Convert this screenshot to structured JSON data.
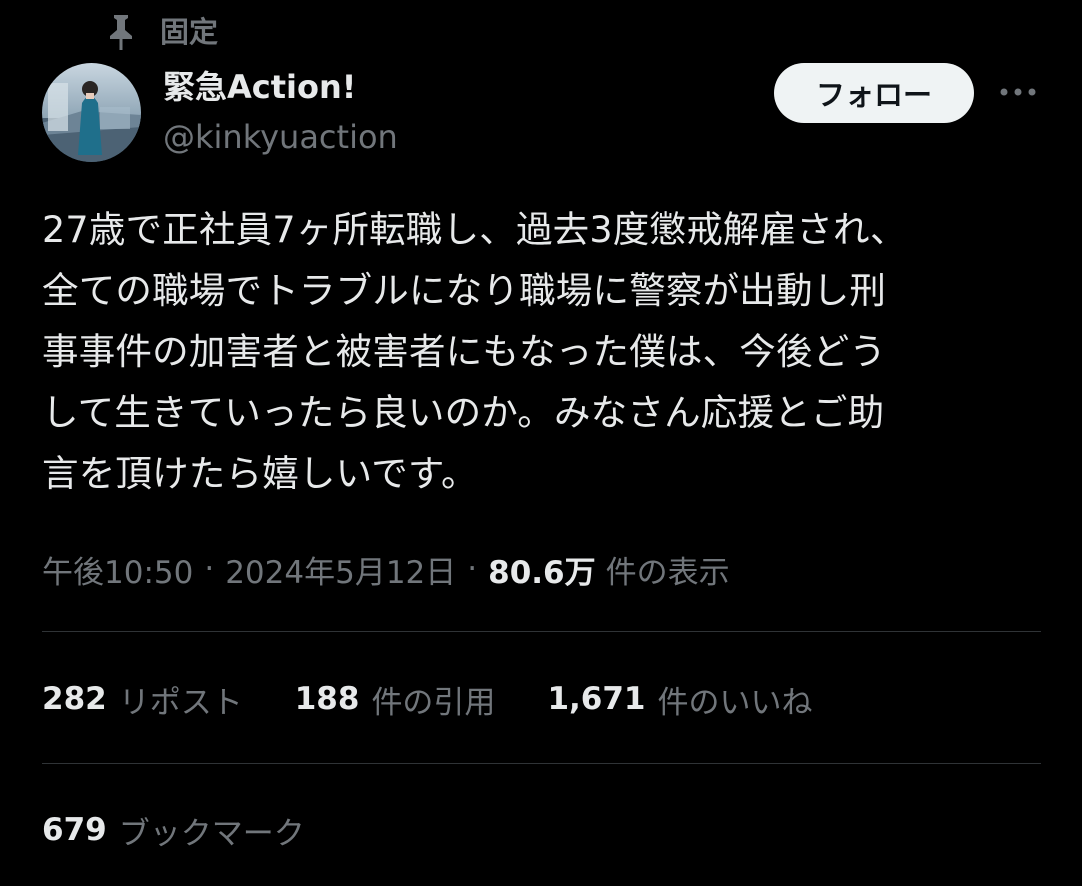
{
  "pinned": {
    "label": "固定"
  },
  "author": {
    "display_name": "緊急Action!",
    "handle": "@kinkyuaction"
  },
  "follow_button": {
    "label": "フォロー"
  },
  "post": {
    "lines": [
      "27歳で正社員7ヶ所転職し、過去3度懲戒解雇され、",
      "全ての職場でトラブルになり職場に警察が出動し刑",
      "事事件の加害者と被害者にもなった僕は、今後どう",
      "して生きていったら良いのか。みなさん応援とご助",
      "言を頂けたら嬉しいです。"
    ]
  },
  "meta": {
    "time": "午後10:50",
    "separator": "·",
    "date": "2024年5月12日",
    "views_count": "80.6万",
    "views_label": "件の表示"
  },
  "stats": {
    "reposts": {
      "count": "282",
      "label": "リポスト"
    },
    "quotes": {
      "count": "188",
      "label": "件の引用"
    },
    "likes": {
      "count": "1,671",
      "label": "件のいいね"
    },
    "bookmarks": {
      "count": "679",
      "label": "ブックマーク"
    }
  },
  "colors": {
    "background": "#000000",
    "primary_text": "#e7e9ea",
    "secondary_text": "#71767b",
    "divider": "#2f3336",
    "follow_button_bg": "#eff3f4"
  }
}
